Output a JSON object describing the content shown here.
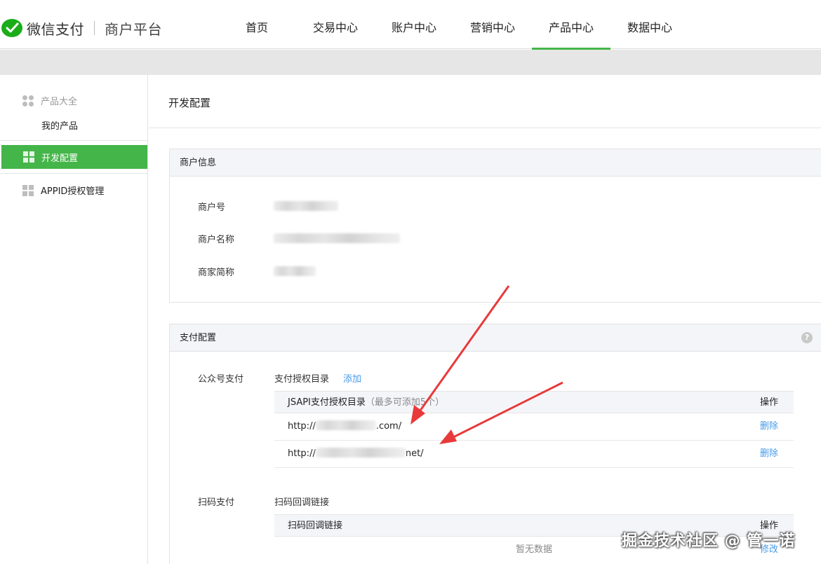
{
  "header": {
    "brand": "微信支付",
    "brand_sub": "商户平台",
    "nav": [
      "首页",
      "交易中心",
      "账户中心",
      "营销中心",
      "产品中心",
      "数据中心"
    ],
    "active_nav": "产品中心"
  },
  "sidebar": {
    "group_title": "产品大全",
    "sub_item": "我的产品",
    "active_item": "开发配置",
    "item_appid": "APPID授权管理"
  },
  "main": {
    "title": "开发配置",
    "merchant_panel": {
      "title": "商户信息",
      "labels": [
        "商户号",
        "商户名称",
        "商家简称"
      ]
    },
    "pay_panel": {
      "title": "支付配置",
      "help": "?",
      "jsapi_label": "公众号支付",
      "jsapi_dir_label": "支付授权目录",
      "jsapi_add": "添加",
      "jsapi_table": {
        "col1": "JSAPI支付授权目录",
        "col1_note": "（最多可添加5个）",
        "col2": "操作",
        "rows": [
          {
            "prefix": "http://",
            "suffix": ".com/",
            "op": "删除"
          },
          {
            "prefix": "http://",
            "suffix": "net/",
            "op": "删除"
          }
        ]
      },
      "native_label": "扫码支付",
      "native_link_label": "扫码回调链接",
      "native_table": {
        "col1": "扫码回调链接",
        "col2": "操作",
        "empty": "暂无数据",
        "op": "修改"
      }
    }
  },
  "watermark": "掘金技术社区 @ 管一诺",
  "colors": {
    "accent": "#44b549",
    "link": "#459ae9",
    "arrow": "#e83a3a"
  }
}
